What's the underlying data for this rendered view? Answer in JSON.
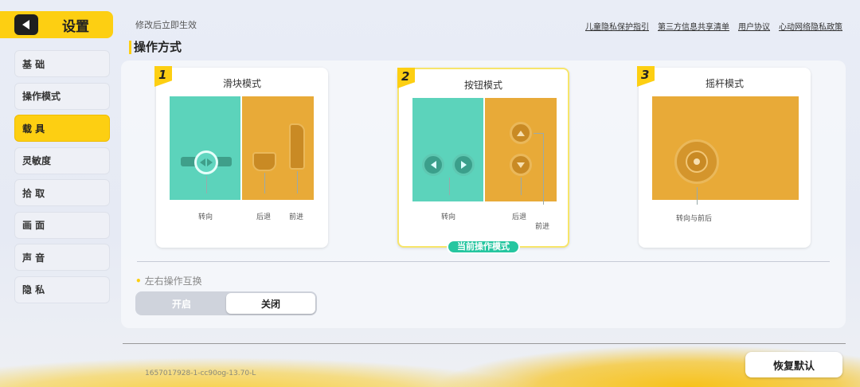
{
  "header": {
    "title": "设置",
    "hint": "修改后立即生效",
    "links": [
      "儿童隐私保护指引",
      "第三方信息共享清单",
      "用户协议",
      "心动网络隐私政策"
    ]
  },
  "sidebar": {
    "items": [
      {
        "label": "基 础",
        "active": false
      },
      {
        "label": "操作模式",
        "active": false
      },
      {
        "label": "载 具",
        "active": true
      },
      {
        "label": "灵敏度",
        "active": false
      },
      {
        "label": "拾 取",
        "active": false
      },
      {
        "label": "画 面",
        "active": false
      },
      {
        "label": "声 音",
        "active": false
      },
      {
        "label": "隐 私",
        "active": false
      }
    ]
  },
  "main": {
    "section_title": "操作方式",
    "modes": [
      {
        "number": "1",
        "title": "滑块模式",
        "labels": [
          "转向",
          "后退",
          "前进"
        ]
      },
      {
        "number": "2",
        "title": "按钮模式",
        "labels": [
          "转向",
          "后退",
          "前进"
        ],
        "current_badge": "当前操作模式"
      },
      {
        "number": "3",
        "title": "摇杆模式",
        "labels": [
          "转向与前后"
        ]
      }
    ],
    "swap": {
      "label": "左右操作互换",
      "options": [
        "开启",
        "关闭"
      ],
      "selected": "关闭"
    }
  },
  "footer": {
    "version": "1657017928-1-cc90og-13.70-L",
    "restore_label": "恢复默认"
  },
  "colors": {
    "accent": "#fdcf12",
    "green": "#5cd3bb",
    "orange": "#e8aa38",
    "badge": "#26c6a0"
  }
}
